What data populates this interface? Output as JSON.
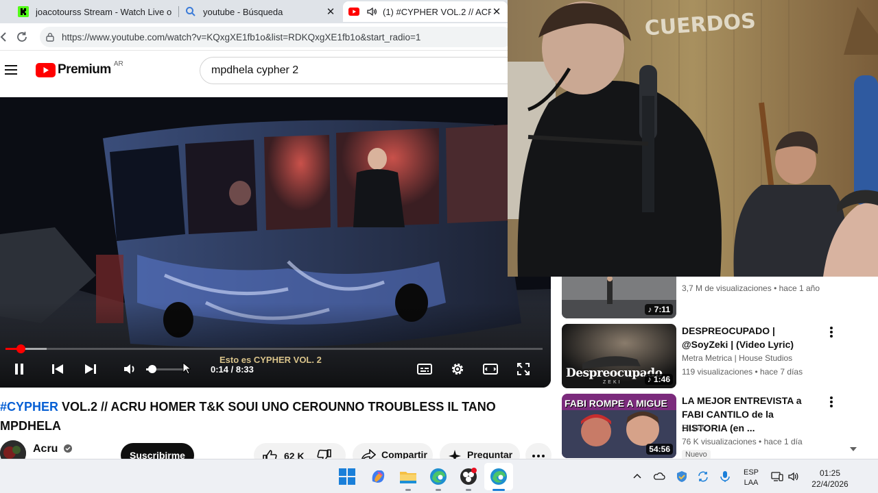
{
  "browser": {
    "tabs": [
      {
        "title": "joacotourss Stream - Watch Live o",
        "icon": "kick-icon"
      },
      {
        "title": "youtube - Búsqueda",
        "icon": "search-icon"
      },
      {
        "title": "(1) #CYPHER VOL.2 // ACRU",
        "icon": "youtube-icon",
        "active": true
      }
    ],
    "url": "https://www.youtube.com/watch?v=KQxgXE1fb1o&list=RDKQxgXE1fb1o&start_radio=1"
  },
  "youtube": {
    "logo_text": "Premium",
    "country": "AR",
    "search_value": "mpdhela cypher 2"
  },
  "player": {
    "chapter": "Esto es CYPHER VOL. 2",
    "time": "0:14 / 8:33",
    "progress": 0.028,
    "volume": 0.15
  },
  "video": {
    "title_tag": "#CYPHER",
    "title_rest": " VOL.2 // ACRU HOMER T&K SOUI UNO CEROUNNO TROUBLESS IL TANO MPDHELA",
    "channel": "Acru",
    "subscribe_label": "Suscribirme",
    "likes": "62 K",
    "share_label": "Compartir",
    "ask_label": "Preguntar"
  },
  "recommendations": [
    {
      "title": "",
      "meta1": "",
      "meta2": "3,7 M de visualizaciones • hace 1 año",
      "duration": "7:11"
    },
    {
      "title": "DESPREOCUPADO | @SoyZeki | (Video Lyric)",
      "meta1": "Metra Metrica | House Studios",
      "meta2": "119 visualizaciones • hace 7 días",
      "duration": "1:46",
      "thumb_text": "Despreocupado",
      "thumb_sub": "ZEKI"
    },
    {
      "title": "LA MEJOR ENTREVISTA a FABI CANTILO de la HISTORIA (en ...",
      "meta1": "OLGA",
      "meta2": "76 K visualizaciones • hace 1 día",
      "duration": "54:56",
      "badge": "Nuevo",
      "thumb_text": "FABI ROMPE A MIGUE"
    }
  ],
  "webcam": {
    "wall_sign": "CUERDOS"
  },
  "taskbar": {
    "lang_line1": "ESP",
    "lang_line2": "LAA",
    "time": "01:25",
    "date": "22/4/2026"
  },
  "colors": {
    "youtube_red": "#ff0000",
    "link_blue": "#065fd4",
    "chapter_gold": "#d9c38a"
  }
}
